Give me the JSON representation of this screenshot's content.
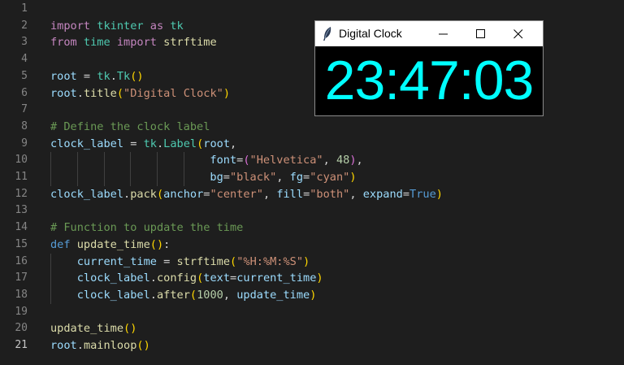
{
  "editor": {
    "line_numbers": [
      "1",
      "2",
      "3",
      "4",
      "5",
      "6",
      "7",
      "8",
      "9",
      "10",
      "11",
      "12",
      "13",
      "14",
      "15",
      "16",
      "17",
      "18",
      "19",
      "20",
      "21"
    ],
    "lines": [
      [],
      [
        {
          "t": "import",
          "c": "kw"
        },
        {
          "t": " tkinter ",
          "c": "mod"
        },
        {
          "t": "as",
          "c": "kw"
        },
        {
          "t": " tk",
          "c": "mod"
        }
      ],
      [
        {
          "t": "from",
          "c": "kw"
        },
        {
          "t": " time ",
          "c": "mod"
        },
        {
          "t": "import",
          "c": "kw"
        },
        {
          "t": " strftime",
          "c": "fn"
        }
      ],
      [],
      [
        {
          "t": "root",
          "c": "var"
        },
        {
          "t": " = ",
          "c": "white"
        },
        {
          "t": "tk",
          "c": "mod"
        },
        {
          "t": ".",
          "c": "white"
        },
        {
          "t": "Tk",
          "c": "mod"
        },
        {
          "t": "()",
          "c": "p1"
        }
      ],
      [
        {
          "t": "root",
          "c": "var"
        },
        {
          "t": ".",
          "c": "white"
        },
        {
          "t": "title",
          "c": "fn"
        },
        {
          "t": "(",
          "c": "p1"
        },
        {
          "t": "\"Digital Clock\"",
          "c": "str"
        },
        {
          "t": ")",
          "c": "p1"
        }
      ],
      [],
      [
        {
          "t": "# Define the clock label",
          "c": "cmt"
        }
      ],
      [
        {
          "t": "clock_label",
          "c": "var"
        },
        {
          "t": " = ",
          "c": "white"
        },
        {
          "t": "tk",
          "c": "mod"
        },
        {
          "t": ".",
          "c": "white"
        },
        {
          "t": "Label",
          "c": "mod"
        },
        {
          "t": "(",
          "c": "p1"
        },
        {
          "t": "root",
          "c": "var"
        },
        {
          "t": ",",
          "c": "white"
        }
      ],
      [
        {
          "t": "                        ",
          "c": "white"
        },
        {
          "t": "font",
          "c": "var"
        },
        {
          "t": "=",
          "c": "white"
        },
        {
          "t": "(",
          "c": "p2"
        },
        {
          "t": "\"Helvetica\"",
          "c": "str"
        },
        {
          "t": ", ",
          "c": "white"
        },
        {
          "t": "48",
          "c": "num"
        },
        {
          "t": ")",
          "c": "p2"
        },
        {
          "t": ",",
          "c": "white"
        }
      ],
      [
        {
          "t": "                        ",
          "c": "white"
        },
        {
          "t": "bg",
          "c": "var"
        },
        {
          "t": "=",
          "c": "white"
        },
        {
          "t": "\"black\"",
          "c": "str"
        },
        {
          "t": ", ",
          "c": "white"
        },
        {
          "t": "fg",
          "c": "var"
        },
        {
          "t": "=",
          "c": "white"
        },
        {
          "t": "\"cyan\"",
          "c": "str"
        },
        {
          "t": ")",
          "c": "p1"
        }
      ],
      [
        {
          "t": "clock_label",
          "c": "var"
        },
        {
          "t": ".",
          "c": "white"
        },
        {
          "t": "pack",
          "c": "fn"
        },
        {
          "t": "(",
          "c": "p1"
        },
        {
          "t": "anchor",
          "c": "var"
        },
        {
          "t": "=",
          "c": "white"
        },
        {
          "t": "\"center\"",
          "c": "str"
        },
        {
          "t": ", ",
          "c": "white"
        },
        {
          "t": "fill",
          "c": "var"
        },
        {
          "t": "=",
          "c": "white"
        },
        {
          "t": "\"both\"",
          "c": "str"
        },
        {
          "t": ", ",
          "c": "white"
        },
        {
          "t": "expand",
          "c": "var"
        },
        {
          "t": "=",
          "c": "white"
        },
        {
          "t": "True",
          "c": "bool"
        },
        {
          "t": ")",
          "c": "p1"
        }
      ],
      [],
      [
        {
          "t": "# Function to update the time",
          "c": "cmt"
        }
      ],
      [
        {
          "t": "def",
          "c": "bool"
        },
        {
          "t": " ",
          "c": "white"
        },
        {
          "t": "update_time",
          "c": "fn"
        },
        {
          "t": "()",
          "c": "p1"
        },
        {
          "t": ":",
          "c": "white"
        }
      ],
      [
        {
          "t": "    ",
          "c": "white"
        },
        {
          "t": "current_time",
          "c": "var"
        },
        {
          "t": " = ",
          "c": "white"
        },
        {
          "t": "strftime",
          "c": "fn"
        },
        {
          "t": "(",
          "c": "p1"
        },
        {
          "t": "\"%H:%M:%S\"",
          "c": "str"
        },
        {
          "t": ")",
          "c": "p1"
        }
      ],
      [
        {
          "t": "    ",
          "c": "white"
        },
        {
          "t": "clock_label",
          "c": "var"
        },
        {
          "t": ".",
          "c": "white"
        },
        {
          "t": "config",
          "c": "fn"
        },
        {
          "t": "(",
          "c": "p1"
        },
        {
          "t": "text",
          "c": "var"
        },
        {
          "t": "=",
          "c": "white"
        },
        {
          "t": "current_time",
          "c": "var"
        },
        {
          "t": ")",
          "c": "p1"
        }
      ],
      [
        {
          "t": "    ",
          "c": "white"
        },
        {
          "t": "clock_label",
          "c": "var"
        },
        {
          "t": ".",
          "c": "white"
        },
        {
          "t": "after",
          "c": "fn"
        },
        {
          "t": "(",
          "c": "p1"
        },
        {
          "t": "1000",
          "c": "num"
        },
        {
          "t": ", ",
          "c": "white"
        },
        {
          "t": "update_time",
          "c": "var"
        },
        {
          "t": ")",
          "c": "p1"
        }
      ],
      [],
      [
        {
          "t": "update_time",
          "c": "fn"
        },
        {
          "t": "()",
          "c": "p1"
        }
      ],
      [
        {
          "t": "root",
          "c": "var"
        },
        {
          "t": ".",
          "c": "white"
        },
        {
          "t": "mainloop",
          "c": "fn"
        },
        {
          "t": "()",
          "c": "p1"
        }
      ]
    ],
    "active_line": 21
  },
  "tk_window": {
    "title": "Digital Clock",
    "clock_text": "23:47:03",
    "icon": "feather-icon",
    "controls": [
      "minimize-icon",
      "maximize-icon",
      "close-icon"
    ]
  },
  "colors": {
    "editor_bg": "#1e1e1e",
    "clock_fg": "#00ffff",
    "clock_bg": "#000000"
  }
}
